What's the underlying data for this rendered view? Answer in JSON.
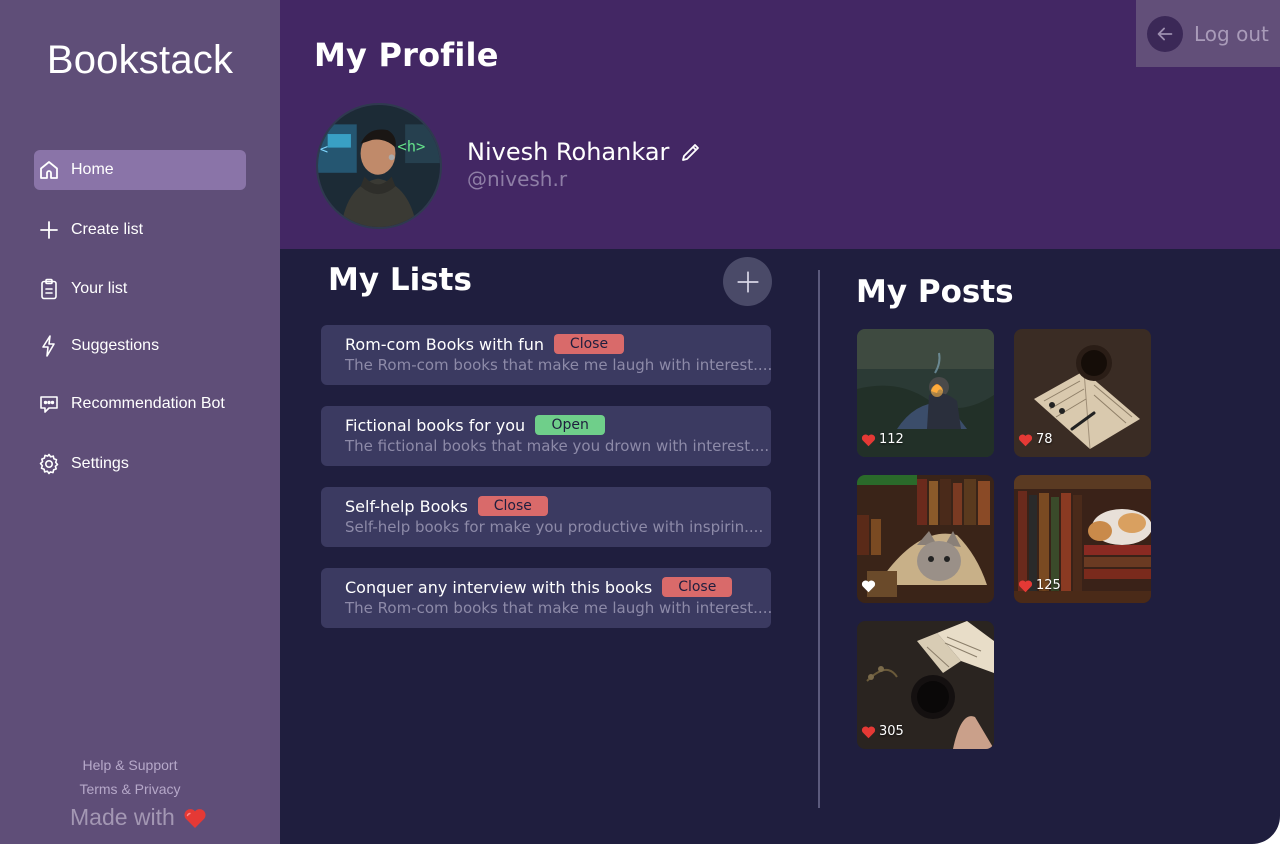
{
  "app": {
    "brand": "Bookstack"
  },
  "sidebar": {
    "items": [
      {
        "label": "Home",
        "icon": "home-icon",
        "active": true
      },
      {
        "label": "Create list",
        "icon": "plus-icon",
        "active": false
      },
      {
        "label": "Your list",
        "icon": "clipboard-icon",
        "active": false
      },
      {
        "label": "Suggestions",
        "icon": "lightning-icon",
        "active": false
      },
      {
        "label": "Recommendation Bot",
        "icon": "chat-bubble-icon",
        "active": false
      },
      {
        "label": "Settings",
        "icon": "gear-icon",
        "active": false
      }
    ],
    "footer": {
      "help": "Help & Support",
      "terms": "Terms & Privacy",
      "made_with": "Made with",
      "heart_icon": "heart-icon"
    }
  },
  "header": {
    "title": "My Profile",
    "logout_label": "Log out",
    "user": {
      "name": "Nivesh Rohankar",
      "handle": "@nivesh.r"
    }
  },
  "lists": {
    "title": "My Lists",
    "items": [
      {
        "title": "Rom-com Books with fun",
        "status": "Close",
        "description": "The Rom-com books that make me laugh with interest...."
      },
      {
        "title": "Fictional books for you",
        "status": "Open",
        "description": "The fictional books that make you drown with interest...."
      },
      {
        "title": "Self-help Books",
        "status": "Close",
        "description": "Self-help books for make you productive with inspirin...."
      },
      {
        "title": "Conquer any interview with this books",
        "status": "Close",
        "description": "The Rom-com books that make me laugh with interest...."
      }
    ]
  },
  "posts": {
    "title": "My Posts",
    "items": [
      {
        "likes": "112",
        "liked": true,
        "subject": "campfire"
      },
      {
        "likes": "78",
        "liked": true,
        "subject": "book-and-coffee"
      },
      {
        "likes": "",
        "liked": false,
        "subject": "cat-in-library"
      },
      {
        "likes": "125",
        "liked": true,
        "subject": "cat-on-bookshelf"
      },
      {
        "likes": "305",
        "liked": true,
        "subject": "book-and-tea"
      }
    ]
  },
  "colors": {
    "sidebar": "#5f4e78",
    "header": "#432764",
    "main": "#1f1e3e",
    "card": "#3b3a61",
    "badge_close": "#d96a6a",
    "badge_open": "#6fcf8a",
    "heart": "#e53935"
  }
}
